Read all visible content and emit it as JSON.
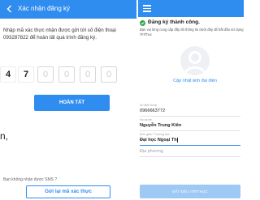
{
  "left_screen": {
    "header": {
      "title": "Xác nhận đăng ký",
      "back_icon": "back-arrow-icon"
    },
    "instruction": "Nhập mã xác thực nhận được gửi tới số điện thoại 093287822 để hoàn tất quá trình đăng ký.",
    "otp_digits": [
      "4",
      "7",
      "0",
      "0",
      "0",
      "0"
    ],
    "finish_button": "HOÀN TẤT",
    "stray_text_1": "n,",
    "stray_text_2": "",
    "no_sms_label": "Bạn không nhận được SMS ?",
    "resend_button": "Gửi lại mã xác thực"
  },
  "right_screen": {
    "header": {
      "menu_icon": "menu-icon"
    },
    "success_title": "Đăng ký thành công.",
    "success_description": "Bạn vui lòng cung cấp đầy đủ thông tin dưới đây để bắt đầu sử dụng iTriThuc",
    "update_photo": "Cập nhật ảnh đại diện",
    "fields": [
      {
        "label": "Số điện thoại",
        "value": "0966663772"
      },
      {
        "label": "Họ và tên",
        "value": "Nguyễn Trung Kiên"
      },
      {
        "label": "Đơn giáo / Trường học",
        "value": "Đại học Ngoại Th"
      },
      {
        "label": "",
        "placeholder": "Địa phương"
      }
    ],
    "start_button": "BẮT ĐẦU iTRITHUC"
  },
  "colors": {
    "primary": "#2f8df0",
    "success": "#2aa84a",
    "disabled_button": "#9ec9f5"
  }
}
